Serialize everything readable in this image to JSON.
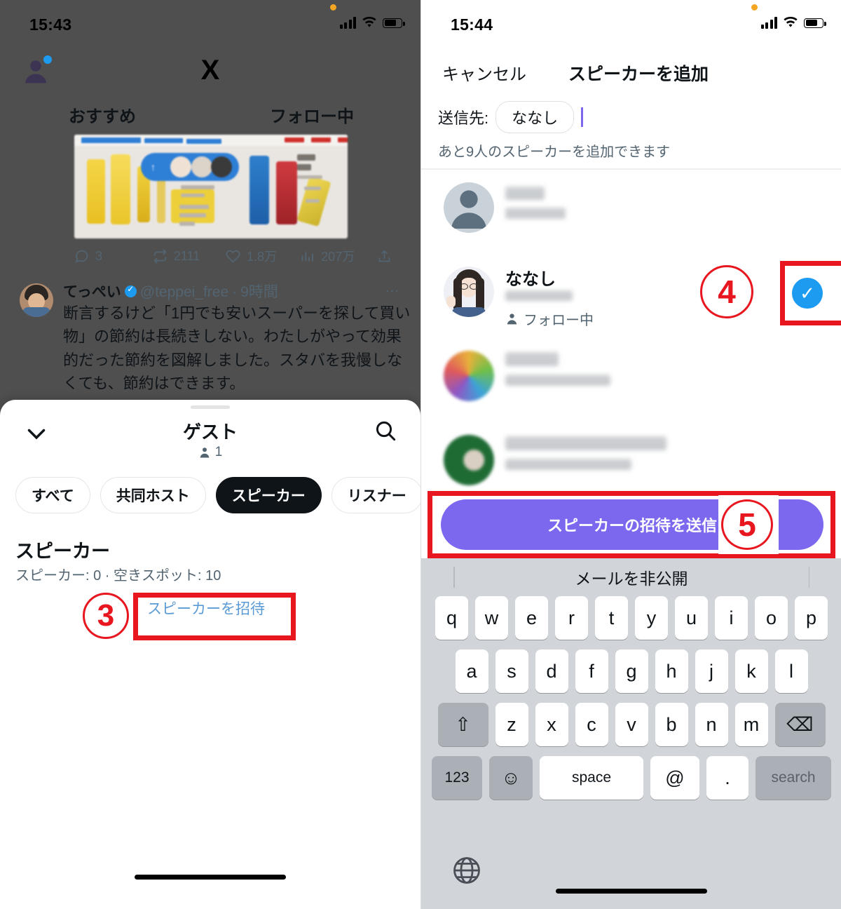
{
  "left_phone": {
    "status_bar": {
      "time": "15:43"
    },
    "app": {
      "logo": "X"
    },
    "tabs": [
      {
        "label": "おすすめ"
      },
      {
        "label": "フォロー中"
      }
    ],
    "tweet_actions": {
      "reply_count": "3",
      "retweet_count": "2111",
      "like_count": "1.8万",
      "view_count": "207万"
    },
    "tweet": {
      "name": "てっぺい",
      "handle": "@teppei_free",
      "time": "9時間",
      "separator": "·",
      "more": "…",
      "body": "断言するけど「1円でも安いスーパーを探して買い物」の節約は長続きしない。わたしがやって効果的だった節約を図解しました。スタバを我慢しなくても、節約はできます。"
    },
    "sheet": {
      "title": "ゲスト",
      "member_count": "1",
      "chips": [
        {
          "label": "すべて",
          "selected": false
        },
        {
          "label": "共同ホスト",
          "selected": false
        },
        {
          "label": "スピーカー",
          "selected": true
        },
        {
          "label": "リスナー",
          "selected": false
        },
        {
          "label": "",
          "selected": false
        }
      ],
      "section_title": "スピーカー",
      "section_sub": "スピーカー: 0 · 空きスポット: 10",
      "invite_link": "スピーカーを招待"
    }
  },
  "right_phone": {
    "status_bar": {
      "time": "15:44"
    },
    "nav": {
      "cancel": "キャンセル",
      "title": "スピーカーを追加"
    },
    "recipients": {
      "label": "送信先:",
      "chip": "ななし"
    },
    "hint": "あと9人のスピーカーを追加できます",
    "users": [
      {
        "name": "",
        "handle": "",
        "follow": "",
        "selected": false,
        "redacted": true,
        "avatar": "default-person"
      },
      {
        "name": "ななし",
        "handle": "",
        "follow": "フォロー中",
        "selected": true,
        "redacted": false,
        "avatar": "illustration-woman"
      },
      {
        "name": "",
        "handle": "",
        "follow": "",
        "selected": false,
        "redacted": true,
        "avatar": "colorful"
      },
      {
        "name": "",
        "handle": "",
        "follow": "",
        "selected": false,
        "redacted": true,
        "avatar": "green-dark"
      }
    ],
    "send_button": "スピーカーの招待を送信",
    "keyboard": {
      "suggestion": "メールを非公開",
      "row1": [
        "q",
        "w",
        "e",
        "r",
        "t",
        "y",
        "u",
        "i",
        "o",
        "p"
      ],
      "row2": [
        "a",
        "s",
        "d",
        "f",
        "g",
        "h",
        "j",
        "k",
        "l"
      ],
      "row3": [
        "z",
        "x",
        "c",
        "v",
        "b",
        "n",
        "m"
      ],
      "shift": "⇧",
      "backspace": "⌫",
      "numbers": "123",
      "emoji": "☺",
      "space": "space",
      "at": "@",
      "period": ".",
      "search": "search",
      "globe": "globe-icon"
    }
  },
  "annotations": [
    {
      "id": "3",
      "label": "③",
      "target": "invite-speaker-link"
    },
    {
      "id": "4",
      "label": "④",
      "target": "user-select-checkmark"
    },
    {
      "id": "5",
      "label": "⑤",
      "target": "send-invite-button"
    }
  ],
  "colors": {
    "accent_blue": "#1d9bf0",
    "link_blue": "#5a9bd5",
    "purple": "#7b68ee",
    "annotation_red": "#e8161f",
    "dark": "#0f1419",
    "muted": "#536471"
  }
}
